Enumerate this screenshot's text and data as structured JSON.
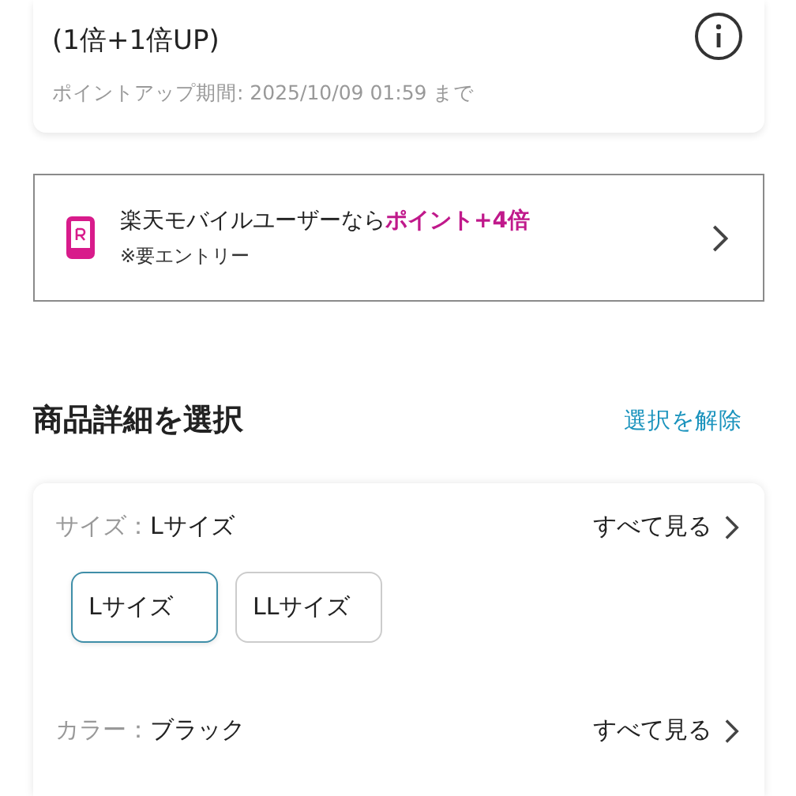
{
  "point_card": {
    "multiplier": "(1倍+1倍UP)",
    "period": "ポイントアップ期間: 2025/10/09 01:59 まで"
  },
  "mobile_banner": {
    "lead": "楽天モバイルユーザーなら",
    "highlight": "ポイント+4倍",
    "note": "※要エントリー"
  },
  "section": {
    "title": "商品詳細を選択",
    "clear_link": "選択を解除"
  },
  "option_groups": [
    {
      "label": "サイズ：",
      "value": "Lサイズ",
      "see_all": "すべて見る",
      "choices": [
        {
          "label": "Lサイズ",
          "selected": true
        },
        {
          "label": "LLサイズ",
          "selected": false
        }
      ]
    },
    {
      "label": "カラー：",
      "value": "ブラック",
      "see_all": "すべて見る"
    }
  ]
}
